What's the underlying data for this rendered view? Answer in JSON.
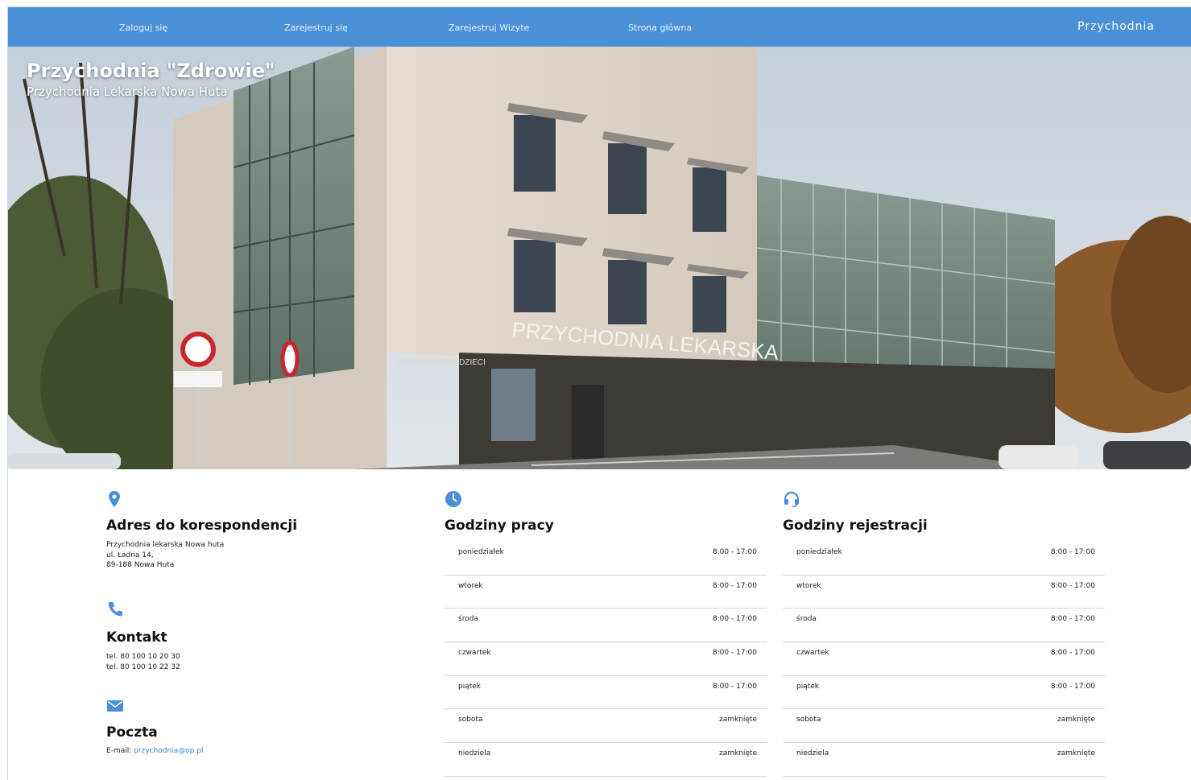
{
  "nav": {
    "links": [
      "Zaloguj się",
      "Zarejestruj się",
      "Zarejestruj Wizyte",
      "Strona główna"
    ],
    "brand": "Przychodnia"
  },
  "hero": {
    "title": "Przychodnia \"Zdrowie\"",
    "subtitle": "Przychodnia Lekarska Nowa Huta",
    "building_sign": "PRZYCHODNIA LEKARSKA",
    "side_sign": "PORADNIA DLA DZIECI"
  },
  "address": {
    "icon": "map-marker-icon",
    "heading": "Adres do korespondencji",
    "lines": [
      "Przychodnia lekarska Nowa huta",
      "ul. Ładna 14,",
      "89-188 Nowa Huta"
    ]
  },
  "contact": {
    "icon": "phone-icon",
    "heading": "Kontakt",
    "lines": [
      "tel. 80 100 10 20 30",
      "tel. 80 100 10 22 32"
    ]
  },
  "mail": {
    "icon": "envelope-icon",
    "heading": "Poczta",
    "label": "E-mail:",
    "email": "przychodnia@op.pl"
  },
  "work_hours": {
    "icon": "clock-icon",
    "heading": "Godziny pracy",
    "rows": [
      {
        "day": "poniedziałek",
        "time": "8:00 - 17:00"
      },
      {
        "day": "wtorek",
        "time": "8:00 - 17:00"
      },
      {
        "day": "środa",
        "time": "8:00 - 17:00"
      },
      {
        "day": "czwartek",
        "time": "8:00 - 17:00"
      },
      {
        "day": "piątek",
        "time": "8:00 - 17:00"
      },
      {
        "day": "sobota",
        "time": "zamknięte"
      },
      {
        "day": "niedziela",
        "time": "zamknięte"
      }
    ]
  },
  "registration_hours": {
    "icon": "headset-icon",
    "heading": "Godziny rejestracji",
    "rows": [
      {
        "day": "poniedziałek",
        "time": "8:00 - 17:00"
      },
      {
        "day": "wtorek",
        "time": "8:00 - 17:00"
      },
      {
        "day": "środa",
        "time": "8:00 - 17:00"
      },
      {
        "day": "czwartek",
        "time": "8:00 - 17:00"
      },
      {
        "day": "piątek",
        "time": "8:00 - 17:00"
      },
      {
        "day": "sobota",
        "time": "zamknięte"
      },
      {
        "day": "niedziela",
        "time": "zamknięte"
      }
    ]
  },
  "colors": {
    "navbar": "#4a90d6",
    "accent": "#3b86cf"
  }
}
